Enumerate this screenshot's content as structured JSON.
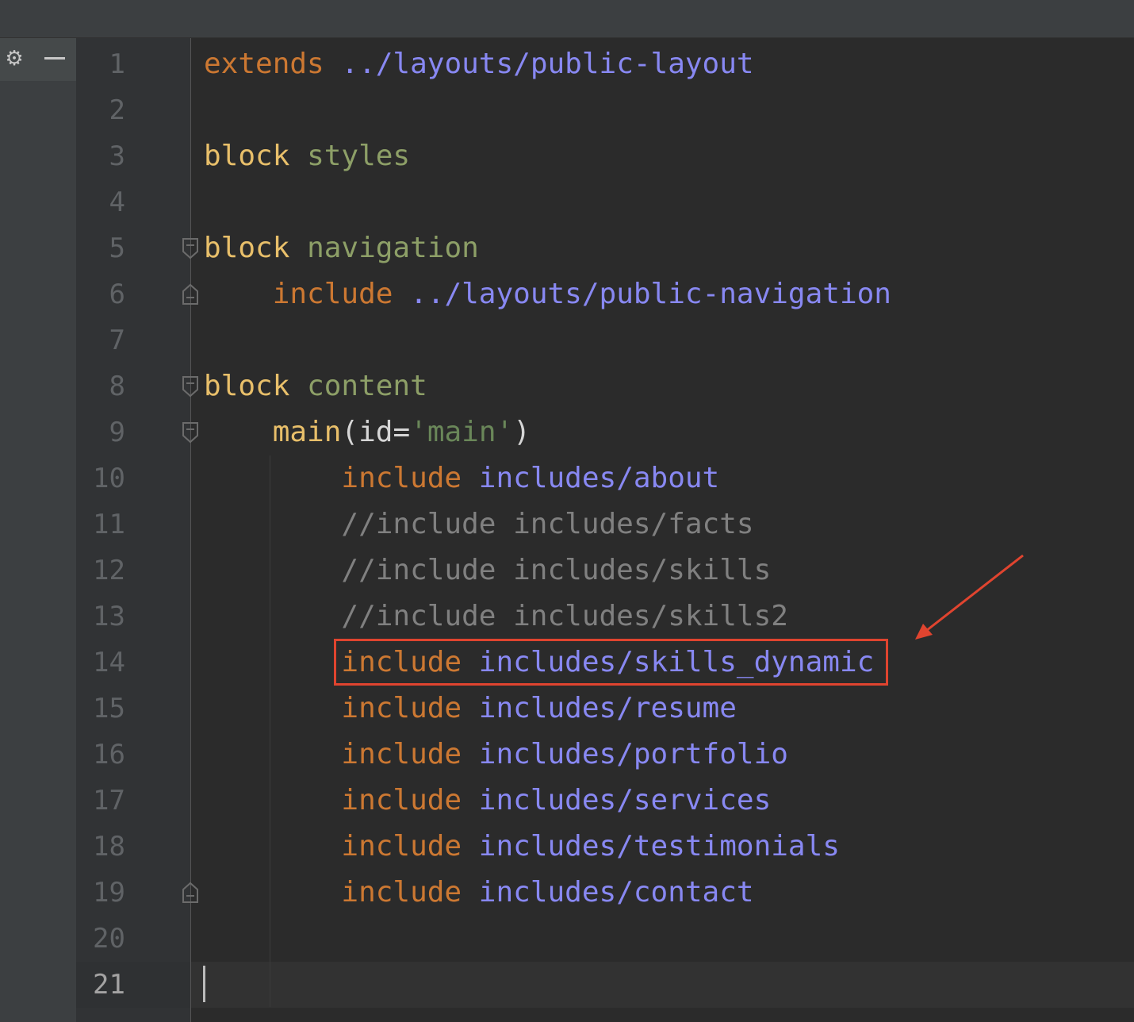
{
  "toolbar": {
    "gear_icon": "⚙",
    "minimize_icon": "minimize-icon"
  },
  "editor": {
    "current_line": 21,
    "lines": [
      {
        "number": "1",
        "segments": [
          {
            "t": "extends",
            "c": "kw"
          },
          {
            "t": " ",
            "c": ""
          },
          {
            "t": "../layouts/public-layout",
            "c": "path"
          }
        ]
      },
      {
        "number": "2",
        "segments": []
      },
      {
        "number": "3",
        "segments": [
          {
            "t": "block",
            "c": "kw-block"
          },
          {
            "t": " ",
            "c": ""
          },
          {
            "t": "styles",
            "c": "name"
          }
        ]
      },
      {
        "number": "4",
        "segments": []
      },
      {
        "number": "5",
        "segments": [
          {
            "t": "block",
            "c": "kw-block"
          },
          {
            "t": " ",
            "c": ""
          },
          {
            "t": "navigation",
            "c": "name"
          }
        ]
      },
      {
        "number": "6",
        "segments": [
          {
            "t": "    ",
            "c": ""
          },
          {
            "t": "include",
            "c": "kw"
          },
          {
            "t": " ",
            "c": ""
          },
          {
            "t": "../layouts/public-navigation",
            "c": "path"
          }
        ]
      },
      {
        "number": "7",
        "segments": []
      },
      {
        "number": "8",
        "segments": [
          {
            "t": "block",
            "c": "kw-block"
          },
          {
            "t": " ",
            "c": ""
          },
          {
            "t": "content",
            "c": "name"
          }
        ]
      },
      {
        "number": "9",
        "segments": [
          {
            "t": "    ",
            "c": ""
          },
          {
            "t": "main",
            "c": "tag"
          },
          {
            "t": "(",
            "c": "punct"
          },
          {
            "t": "id",
            "c": "punct"
          },
          {
            "t": "=",
            "c": "punct"
          },
          {
            "t": "'main'",
            "c": "str"
          },
          {
            "t": ")",
            "c": "punct"
          }
        ]
      },
      {
        "number": "10",
        "segments": [
          {
            "t": "        ",
            "c": ""
          },
          {
            "t": "include",
            "c": "kw"
          },
          {
            "t": " ",
            "c": ""
          },
          {
            "t": "includes/about",
            "c": "path"
          }
        ]
      },
      {
        "number": "11",
        "segments": [
          {
            "t": "        ",
            "c": ""
          },
          {
            "t": "//include includes/facts",
            "c": "comment"
          }
        ]
      },
      {
        "number": "12",
        "segments": [
          {
            "t": "        ",
            "c": ""
          },
          {
            "t": "//include includes/skills",
            "c": "comment"
          }
        ]
      },
      {
        "number": "13",
        "segments": [
          {
            "t": "        ",
            "c": ""
          },
          {
            "t": "//include includes/skills2",
            "c": "comment"
          }
        ]
      },
      {
        "number": "14",
        "segments": [
          {
            "t": "        ",
            "c": ""
          },
          {
            "t": "include",
            "c": "kw"
          },
          {
            "t": " ",
            "c": ""
          },
          {
            "t": "includes/skills_dynamic",
            "c": "path"
          }
        ]
      },
      {
        "number": "15",
        "segments": [
          {
            "t": "        ",
            "c": ""
          },
          {
            "t": "include",
            "c": "kw"
          },
          {
            "t": " ",
            "c": ""
          },
          {
            "t": "includes/resume",
            "c": "path"
          }
        ]
      },
      {
        "number": "16",
        "segments": [
          {
            "t": "        ",
            "c": ""
          },
          {
            "t": "include",
            "c": "kw"
          },
          {
            "t": " ",
            "c": ""
          },
          {
            "t": "includes/portfolio",
            "c": "path"
          }
        ]
      },
      {
        "number": "17",
        "segments": [
          {
            "t": "        ",
            "c": ""
          },
          {
            "t": "include",
            "c": "kw"
          },
          {
            "t": " ",
            "c": ""
          },
          {
            "t": "includes/services",
            "c": "path"
          }
        ]
      },
      {
        "number": "18",
        "segments": [
          {
            "t": "        ",
            "c": ""
          },
          {
            "t": "include",
            "c": "kw"
          },
          {
            "t": " ",
            "c": ""
          },
          {
            "t": "includes/testimonials",
            "c": "path"
          }
        ]
      },
      {
        "number": "19",
        "segments": [
          {
            "t": "        ",
            "c": ""
          },
          {
            "t": "include",
            "c": "kw"
          },
          {
            "t": " ",
            "c": ""
          },
          {
            "t": "includes/contact",
            "c": "path"
          }
        ]
      },
      {
        "number": "20",
        "segments": []
      },
      {
        "number": "21",
        "segments": []
      }
    ],
    "fold_markers": [
      {
        "line": 5,
        "kind": "open"
      },
      {
        "line": 6,
        "kind": "close"
      },
      {
        "line": 8,
        "kind": "open"
      },
      {
        "line": 9,
        "kind": "open"
      },
      {
        "line": 19,
        "kind": "close"
      }
    ],
    "highlighted_line": 14
  },
  "colors": {
    "background": "#2b2b2b",
    "gutter": "#313335",
    "keyword": "#cc7832",
    "block": "#e8bf6a",
    "path": "#8888f2",
    "name": "#8d9f67",
    "comment": "#808080",
    "string": "#6a8759",
    "annotation": "#e0442f"
  }
}
